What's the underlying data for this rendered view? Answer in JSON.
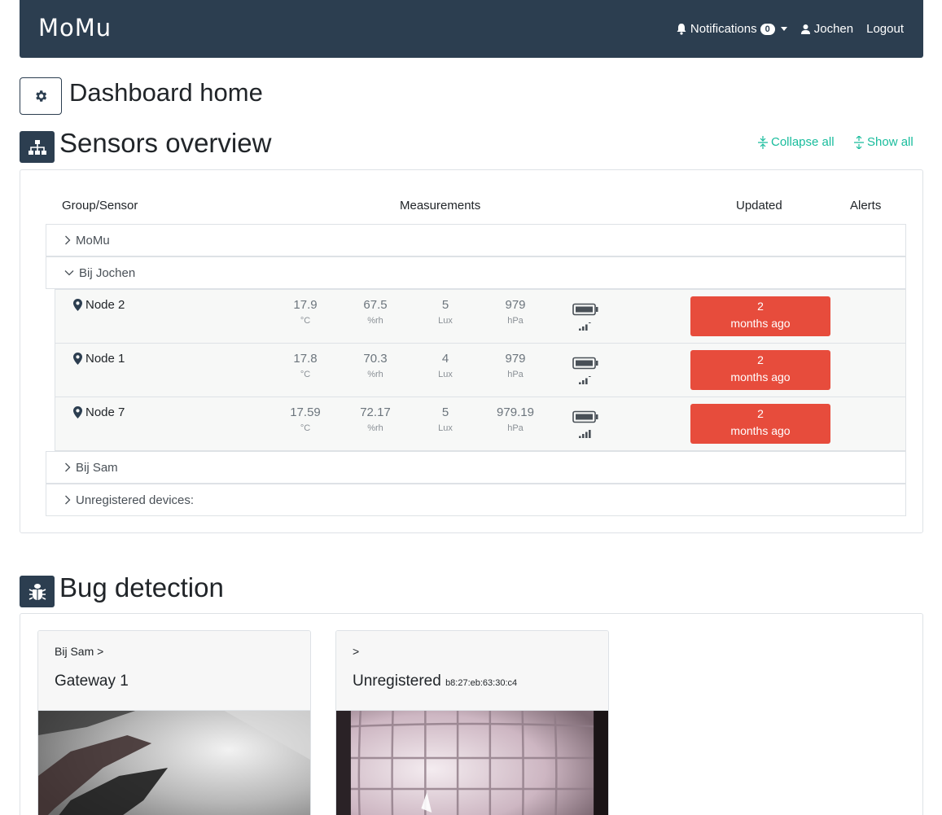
{
  "nav": {
    "logo": "MoMu",
    "notifications_label": "Notifications",
    "notifications_count": "0",
    "user": "Jochen",
    "logout": "Logout"
  },
  "dashboard": {
    "title": "Dashboard home"
  },
  "sensors": {
    "title": "Sensors overview",
    "collapse_all": "Collapse all",
    "show_all": "Show all",
    "headers": {
      "group": "Group/Sensor",
      "measurements": "Measurements",
      "updated": "Updated",
      "alerts": "Alerts"
    },
    "groups": [
      {
        "name": "MoMu",
        "expanded": false
      },
      {
        "name": "Bij Jochen",
        "expanded": true
      },
      {
        "name": "Bij Sam",
        "expanded": false
      },
      {
        "name": "Unregistered devices:",
        "expanded": false
      }
    ],
    "units": [
      "°C",
      "%rh",
      "Lux",
      "hPa"
    ],
    "nodes": [
      {
        "name": "Node 2",
        "temp": "17.9",
        "hum": "67.5",
        "lux": "5",
        "pres": "979",
        "signal_bars": 3,
        "updated_1": "2",
        "updated_2": "months ago"
      },
      {
        "name": "Node 1",
        "temp": "17.8",
        "hum": "70.3",
        "lux": "4",
        "pres": "979",
        "signal_bars": 3,
        "updated_1": "2",
        "updated_2": "months ago"
      },
      {
        "name": "Node 7",
        "temp": "17.59",
        "hum": "72.17",
        "lux": "5",
        "pres": "979.19",
        "signal_bars": 4,
        "updated_1": "2",
        "updated_2": "months ago"
      }
    ]
  },
  "bugs": {
    "title": "Bug detection",
    "cards": [
      {
        "crumb": "Bij Sam >",
        "title": "Gateway 1",
        "id": ""
      },
      {
        "crumb": ">",
        "title": "Unregistered",
        "id": "b8:27:eb:63:30:c4"
      }
    ]
  },
  "colors": {
    "navbar": "#2c3e50",
    "accent": "#18bc9c",
    "alert": "#e74c3c"
  }
}
